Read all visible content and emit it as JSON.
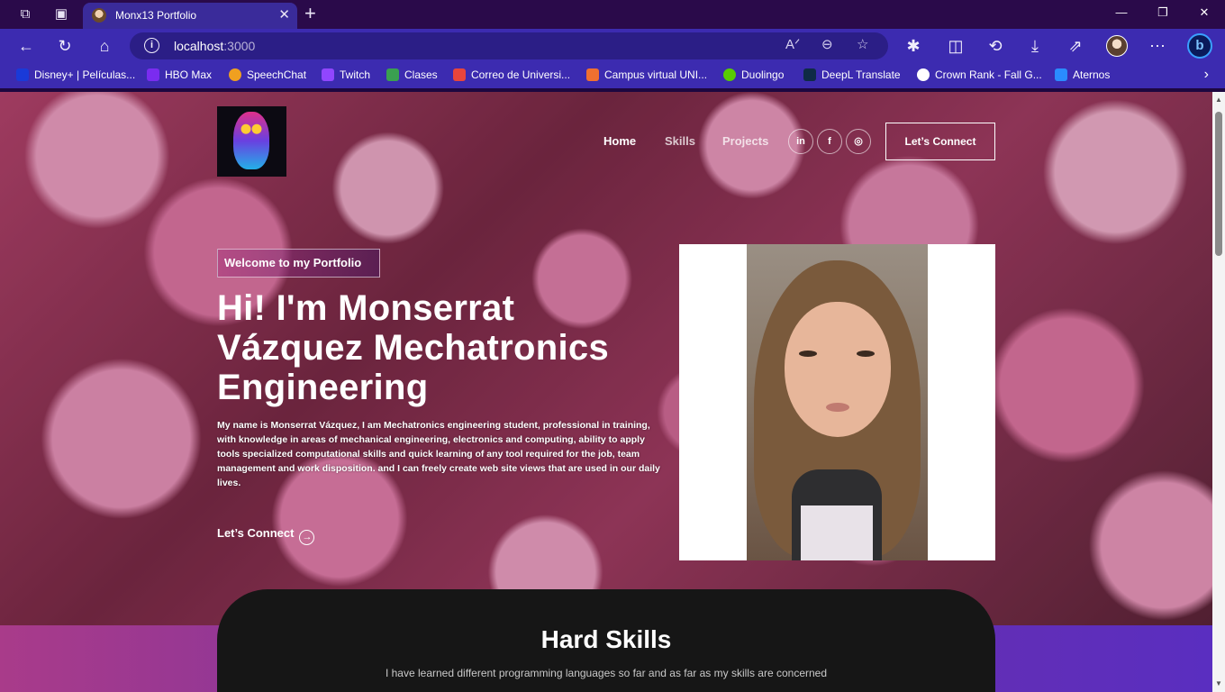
{
  "browser": {
    "tab_title": "Monx13 Portfolio",
    "url_host": "localhost",
    "url_port": ":3000",
    "bookmarks": [
      {
        "label": "Disney+ | Películas...",
        "color": "#1a3ad8"
      },
      {
        "label": "HBO Max",
        "color": "#7a2cf0"
      },
      {
        "label": "SpeechChat",
        "color": "#f0a020"
      },
      {
        "label": "Twitch",
        "color": "#9146ff"
      },
      {
        "label": "Clases",
        "color": "#3aa050"
      },
      {
        "label": "Correo de Universi...",
        "color": "#e8453c"
      },
      {
        "label": "Campus virtual UNI...",
        "color": "#f07030"
      },
      {
        "label": "Duolingo",
        "color": "#58cc02"
      },
      {
        "label": "DeepL Translate",
        "color": "#0f2b46"
      },
      {
        "label": "Crown Rank - Fall G...",
        "color": "#ffffff"
      },
      {
        "label": "Aternos",
        "color": "#2a8cff"
      }
    ]
  },
  "site": {
    "nav": {
      "home": "Home",
      "skills": "Skills",
      "projects": "Projects",
      "social": [
        "in",
        "f",
        "◎"
      ],
      "connect": "Let’s Connect"
    },
    "hero": {
      "tagline": "Welcome to my Portfolio",
      "headline": "Hi! I'm Monserrat Vázquez Mechatronics Engineering",
      "bio": "My name is Monserrat Vázquez, I am Mechatronics engineering student, professional in training, with knowledge in areas of mechanical engineering, electronics and computing, ability to apply tools specialized computational skills and quick learning of any tool required for the job, team management and work disposition. and I can freely create web site views that are used in our daily lives.",
      "cta": "Let’s Connect"
    },
    "skills": {
      "title": "Hard Skills",
      "subtitle": "I have learned different programming languages so far and as far as my skills are concerned"
    }
  },
  "colors": {
    "chrome_title": "#2a0a4a",
    "chrome_nav": "#3c2bb0",
    "skills_card": "#161616",
    "band_start": "#a93b8a",
    "band_end": "#5a2ec0"
  }
}
